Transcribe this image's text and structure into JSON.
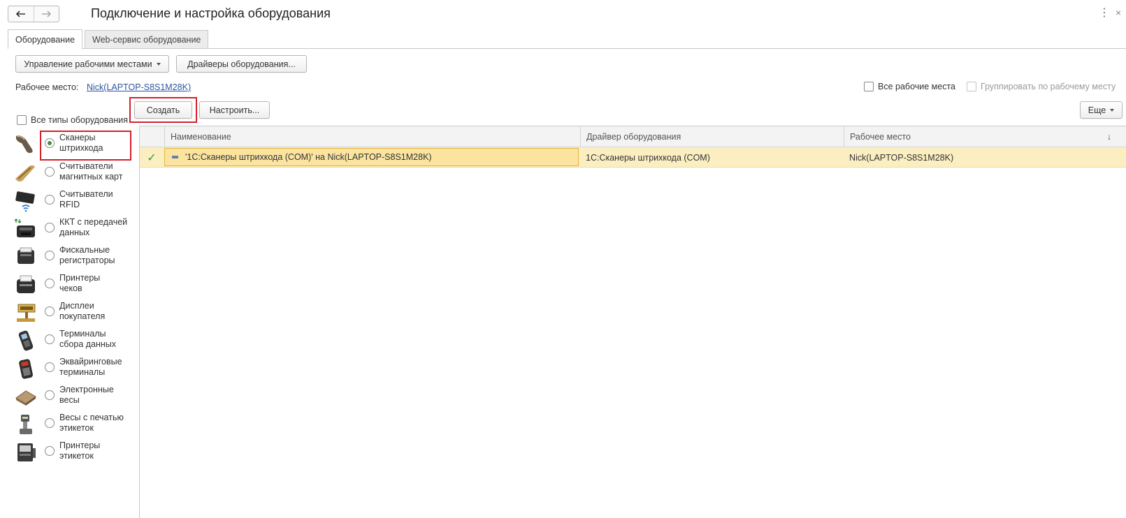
{
  "window": {
    "title": "Подключение и настройка оборудования",
    "back_icon": "arrow-left-icon",
    "forward_icon": "arrow-right-icon",
    "menu_icon": "more-vertical-icon",
    "close_icon": "close-icon",
    "menu_glyph": "⋮",
    "close_glyph": "×"
  },
  "tabs": [
    {
      "label": "Оборудование",
      "active": true
    },
    {
      "label": "Web-сервис оборудование",
      "active": false
    }
  ],
  "toolbar": {
    "workplaces_label": "Управление рабочими местами",
    "drivers_label": "Драйверы оборудования..."
  },
  "workplace": {
    "label": "Рабочее место:",
    "value": "Nick(LAPTOP-S8S1M28K)"
  },
  "options": {
    "all_workplaces": "Все рабочие места",
    "group_by_workplace": "Группировать по рабочему месту",
    "all_types": "Все типы оборудования"
  },
  "actions": {
    "create": "Создать",
    "configure": "Настроить...",
    "more": "Еще"
  },
  "equipment_types": [
    {
      "line1": "Сканеры",
      "line2": "штрихкода",
      "selected": true,
      "icon": "barcode-scanner-icon"
    },
    {
      "line1": "Считыватели",
      "line2": "магнитных карт",
      "selected": false,
      "icon": "card-reader-icon"
    },
    {
      "line1": "Считыватели",
      "line2": "RFID",
      "selected": false,
      "icon": "rfid-reader-icon"
    },
    {
      "line1": "ККТ с передачей",
      "line2": "данных",
      "selected": false,
      "icon": "kkt-icon"
    },
    {
      "line1": "Фискальные",
      "line2": "регистраторы",
      "selected": false,
      "icon": "fiscal-registrar-icon"
    },
    {
      "line1": "Принтеры",
      "line2": "чеков",
      "selected": false,
      "icon": "receipt-printer-icon"
    },
    {
      "line1": "Дисплеи",
      "line2": "покупателя",
      "selected": false,
      "icon": "customer-display-icon"
    },
    {
      "line1": "Терминалы",
      "line2": "сбора данных",
      "selected": false,
      "icon": "data-terminal-icon"
    },
    {
      "line1": "Эквайринговые",
      "line2": "терминалы",
      "selected": false,
      "icon": "payment-terminal-icon"
    },
    {
      "line1": "Электронные",
      "line2": "весы",
      "selected": false,
      "icon": "electronic-scales-icon"
    },
    {
      "line1": "Весы с печатью",
      "line2": "этикеток",
      "selected": false,
      "icon": "label-scales-icon"
    },
    {
      "line1": "Принтеры",
      "line2": "этикеток",
      "selected": false,
      "icon": "label-printer-icon"
    }
  ],
  "table": {
    "columns": [
      "Наименование",
      "Драйвер оборудования",
      "Рабочее место"
    ],
    "sort_glyph": "↓",
    "rows": [
      {
        "status_icon": "checkmark-icon",
        "status_glyph": "✓",
        "name": "'1С:Сканеры штрихкода (COM)' на Nick(LAPTOP-S8S1M28K)",
        "driver": "1С:Сканеры штрихкода (COM)",
        "workplace": "Nick(LAPTOP-S8S1M28K)"
      }
    ]
  },
  "colors": {
    "selected_row": "#fbefc2",
    "highlight_frame": "#d4202a",
    "link": "#2b55a1",
    "check": "#3c9a2e"
  }
}
